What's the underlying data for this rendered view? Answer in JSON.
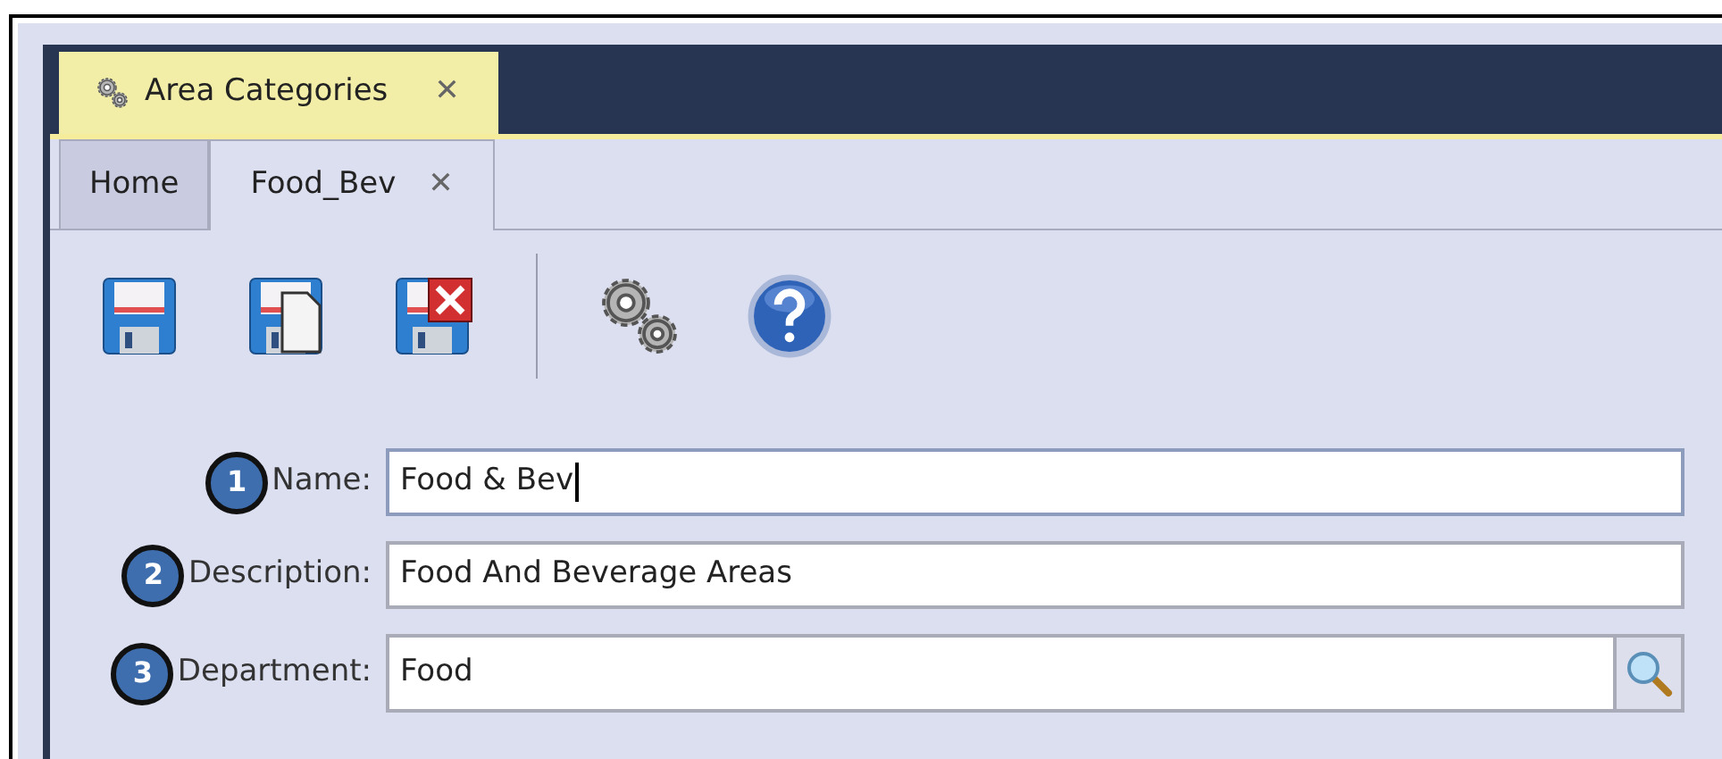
{
  "document_tabs": [
    {
      "label": "Area Categories",
      "close": "✕",
      "selected": true
    }
  ],
  "sub_tabs": [
    {
      "label": "Home",
      "selected": false
    },
    {
      "label": "Food_Bev",
      "close": "✕",
      "selected": true
    }
  ],
  "toolbar": [
    {
      "kind": "save"
    },
    {
      "kind": "save-copy"
    },
    {
      "kind": "save-delete"
    },
    {
      "kind": "separator"
    },
    {
      "kind": "settings"
    },
    {
      "kind": "help"
    }
  ],
  "fields": [
    {
      "step": "1",
      "label": "Name:",
      "value": "Food & Bev",
      "focused": true,
      "kind": "text"
    },
    {
      "step": "2",
      "label": "Description:",
      "value": "Food And Beverage Areas",
      "focused": false,
      "kind": "text"
    },
    {
      "step": "3",
      "label": "Department:",
      "value": "Food",
      "focused": false,
      "kind": "lookup"
    }
  ]
}
